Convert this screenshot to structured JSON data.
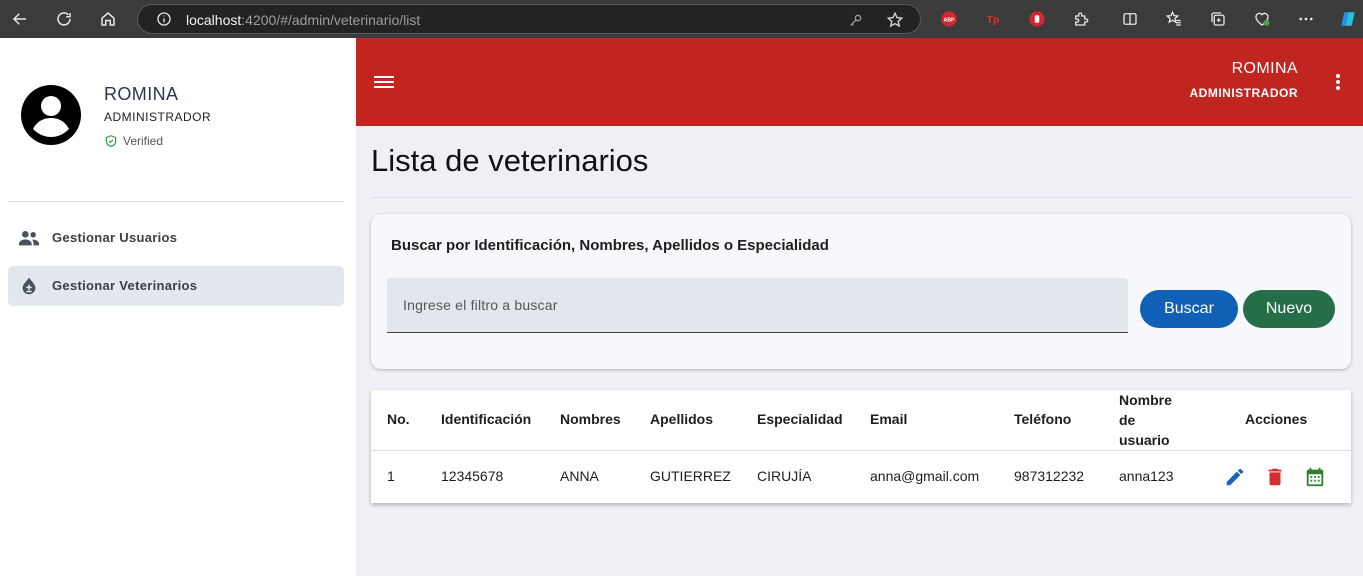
{
  "browser": {
    "url_host": "localhost",
    "url_rest": ":4200/#/admin/veterinario/list",
    "extensions": [
      "adblock-icon",
      "tp-extension-icon",
      "stop-extension-icon",
      "puzzle-extensions-icon",
      "split-screen-icon",
      "favorites-icon",
      "collections-icon",
      "browser-essentials-icon",
      "more-options-icon",
      "copilot-icon"
    ]
  },
  "sidebar": {
    "user_name": "ROMINA",
    "user_role": "ADMINISTRADOR",
    "verified_label": "Verified",
    "items": [
      {
        "label": "Gestionar Usuarios",
        "icon": "group-icon",
        "active": false
      },
      {
        "label": "Gestionar Veterinarios",
        "icon": "water-drop-icon",
        "active": true
      }
    ]
  },
  "appbar": {
    "user_name": "ROMINA",
    "user_role": "ADMINISTRADOR"
  },
  "main": {
    "title": "Lista de veterinarios",
    "search": {
      "heading": "Buscar por Identificación, Nombres, Apellidos o Especialidad",
      "placeholder": "Ingrese el filtro a buscar",
      "search_button": "Buscar",
      "new_button": "Nuevo"
    },
    "table": {
      "headers": {
        "no": "No.",
        "identificacion": "Identificación",
        "nombres": "Nombres",
        "apellidos": "Apellidos",
        "especialidad": "Especialidad",
        "email": "Email",
        "telefono": "Teléfono",
        "usuario_1": "Nombre",
        "usuario_2": "de",
        "usuario_3": "usuario",
        "acciones": "Acciones"
      },
      "rows": [
        {
          "no": "1",
          "identificacion": "12345678",
          "nombres": "ANNA",
          "apellidos": "GUTIERREZ",
          "especialidad": "CIRUJÍA",
          "email": "anna@gmail.com",
          "telefono": "987312232",
          "usuario": "anna123"
        }
      ]
    }
  },
  "colors": {
    "appbar": "#c02520",
    "search_button": "#0f60b6",
    "new_button": "#266d4a",
    "edit_icon": "#1565c0",
    "delete_icon": "#d32f2f",
    "calendar_icon": "#2e7d32"
  }
}
